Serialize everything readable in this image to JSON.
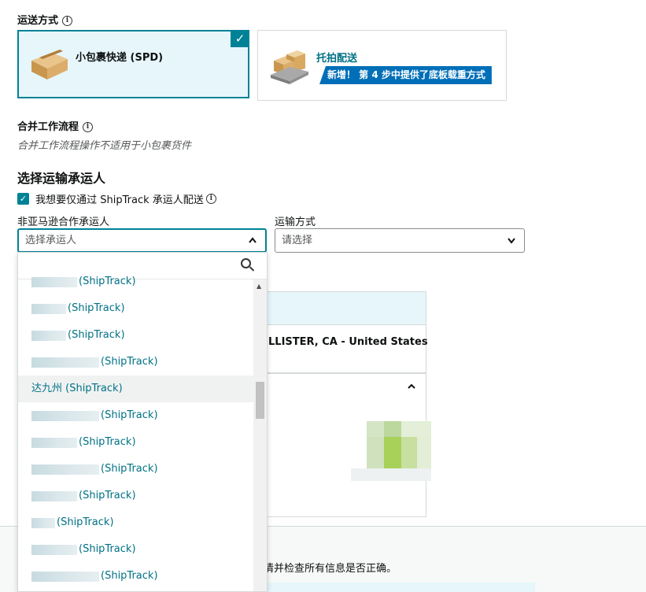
{
  "shipping": {
    "label": "运送方式",
    "info_icon": "i",
    "options": [
      {
        "title": "小包裹快递 (SPD)",
        "selected": true
      },
      {
        "title": "托拍配送",
        "badge": "新增！ 第 4 步中提供了底板载重方式"
      }
    ]
  },
  "merge": {
    "label": "合并工作流程",
    "info_icon": "i",
    "note": "合并工作流程操作不适用于小包裹货件"
  },
  "carrier": {
    "title": "选择运输承运人",
    "checkbox_label": "我想要仅通过 ShipTrack 承运人配送",
    "checkbox_checked": true,
    "non_partner_label": "非亚马逊合作承运人",
    "non_partner_placeholder": "选择承运人",
    "method_label": "运输方式",
    "method_placeholder": "请选择"
  },
  "dropdown": {
    "items": [
      {
        "text": "(ShipTrack)",
        "blur_w": 58
      },
      {
        "text": "(ShipTrack)",
        "blur_w": 44
      },
      {
        "text": "(ShipTrack)",
        "blur_w": 44
      },
      {
        "text": "(ShipTrack)",
        "blur_w": 86
      },
      {
        "text": "达九州 (ShipTrack)",
        "blur_w": 0,
        "highlighted": true
      },
      {
        "text": "(ShipTrack)",
        "blur_w": 86
      },
      {
        "text": "(ShipTrack)",
        "blur_w": 58
      },
      {
        "text": "(ShipTrack)",
        "blur_w": 86
      },
      {
        "text": "(ShipTrack)",
        "blur_w": 58
      },
      {
        "text": "(ShipTrack)",
        "blur_w": 30
      },
      {
        "text": "(ShipTrack)",
        "blur_w": 58
      },
      {
        "text": "(ShipTrack)",
        "blur_w": 86
      }
    ]
  },
  "background": {
    "address_text": "LLISTER, CA",
    "country_sep": "-",
    "country": "United States",
    "review_note": "详情并检查所有信息是否正确。"
  },
  "colors": {
    "accent": "#008296",
    "link": "#007185",
    "badge": "#006fb8"
  }
}
